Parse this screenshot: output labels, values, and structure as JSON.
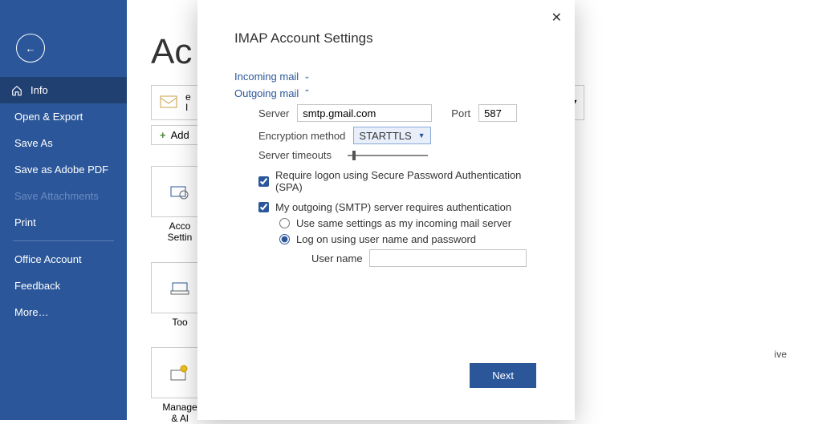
{
  "titlebar": {
    "icons": {
      "smile": "☺",
      "frown": "☹",
      "help": "?",
      "min": "—",
      "max": "☐",
      "close": "✕"
    }
  },
  "sidebar": {
    "back": "←",
    "items": [
      {
        "label": "Info",
        "active": true
      },
      {
        "label": "Open & Export"
      },
      {
        "label": "Save As"
      },
      {
        "label": "Save as Adobe PDF"
      },
      {
        "label": "Save Attachments",
        "disabled": true
      },
      {
        "label": "Print"
      },
      {
        "label": "Office Account"
      },
      {
        "label": "Feedback"
      },
      {
        "label": "More…"
      }
    ]
  },
  "main": {
    "title_fragment": "Ac",
    "account_box_left": "e",
    "account_box_label": "I",
    "add_button": "Add",
    "tiles": [
      {
        "label": "Acco\nSettin"
      },
      {
        "label": "Too"
      },
      {
        "label": "Manage\n& Al"
      }
    ],
    "ive_text": "ive"
  },
  "modal": {
    "title": "IMAP Account Settings",
    "incoming": "Incoming mail",
    "outgoing": "Outgoing mail",
    "server_label": "Server",
    "server_value": "smtp.gmail.com",
    "port_label": "Port",
    "port_value": "587",
    "enc_label": "Encryption method",
    "enc_value": "STARTTLS",
    "timeouts_label": "Server timeouts",
    "spa_label": "Require logon using Secure Password Authentication (SPA)",
    "smtp_auth_label": "My outgoing (SMTP) server requires authentication",
    "radio_same": "Use same settings as my incoming mail server",
    "radio_logon": "Log on using user name and password",
    "username_label": "User name",
    "username_value": "",
    "next_button": "Next",
    "close_glyph": "✕"
  }
}
